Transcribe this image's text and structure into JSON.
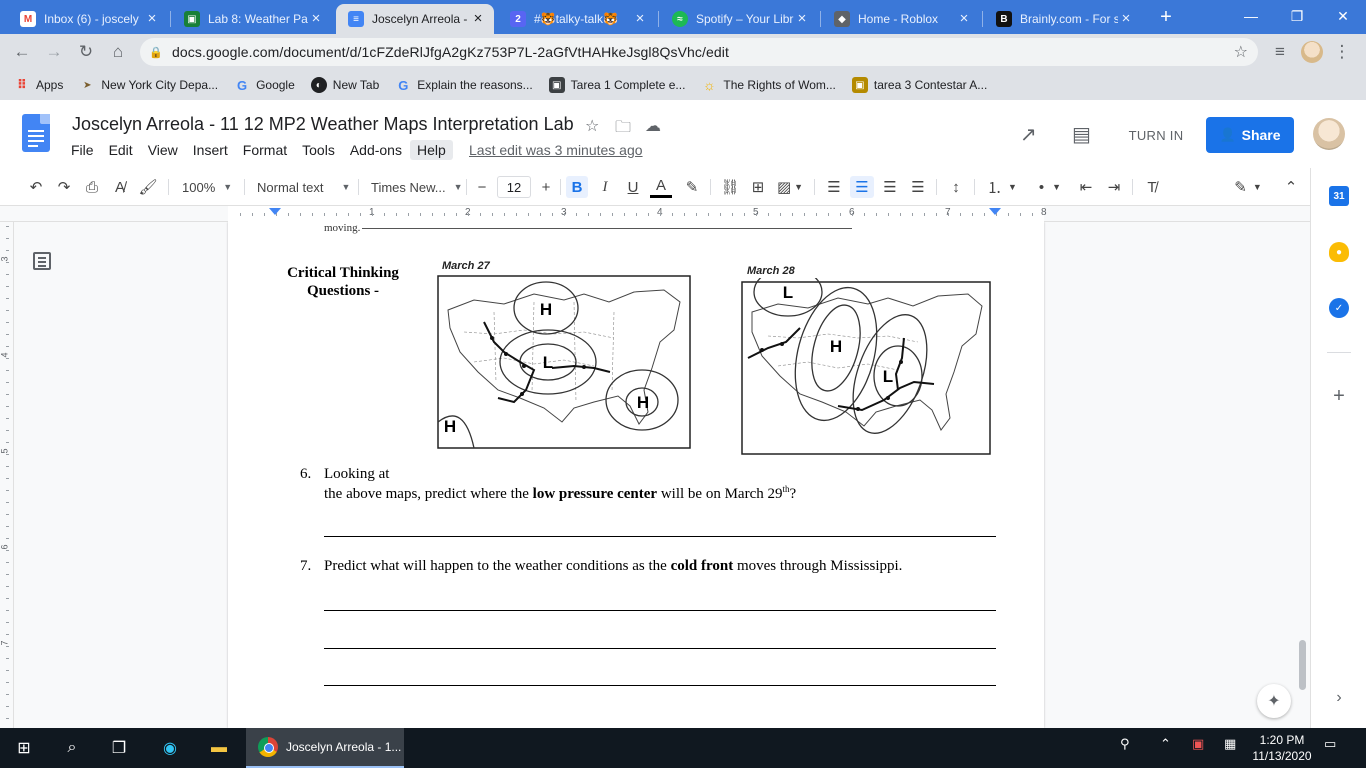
{
  "browser": {
    "tabs": [
      {
        "title": "Inbox (6) - joscely",
        "favicon": "gmail-icon",
        "color": "#ea4335",
        "glyph": "M"
      },
      {
        "title": "Lab 8: Weather Pat",
        "favicon": "classroom-icon",
        "color": "#188038",
        "glyph": "▣"
      },
      {
        "title": "Joscelyn Arreola -",
        "favicon": "docs-icon",
        "color": "#4285f4",
        "glyph": "≡",
        "active": true
      },
      {
        "title": "#🐯talky-talk🐯",
        "favicon": "discord-icon",
        "color": "#5865f2",
        "glyph": "2"
      },
      {
        "title": "Spotify – Your Libr",
        "favicon": "spotify-icon",
        "color": "#1db954",
        "glyph": "≈"
      },
      {
        "title": "Home - Roblox",
        "favicon": "roblox-icon",
        "color": "#444444",
        "glyph": "◆"
      },
      {
        "title": "Brainly.com - For s",
        "favicon": "brainly-icon",
        "color": "#111111",
        "glyph": "B"
      }
    ],
    "url": "docs.google.com/document/d/1cFZdeRlJfgA2gKz753P7L-2aGfVtHAHkeJsgl8QsVhc/edit",
    "bookmarks": [
      {
        "label": "Apps",
        "icon": "apps-grid-icon",
        "color": "#ea4335"
      },
      {
        "label": "New York City Depa...",
        "icon": "nyc-doe-icon",
        "color": "#7b5e2e"
      },
      {
        "label": "Google",
        "icon": "google-icon",
        "color": "#4285f4"
      },
      {
        "label": "New Tab",
        "icon": "globe-icon",
        "color": "#202124"
      },
      {
        "label": "Explain the reasons...",
        "icon": "google-icon",
        "color": "#4285f4"
      },
      {
        "label": "Tarea 1 Complete e...",
        "icon": "classroom-icon",
        "color": "#3c4043"
      },
      {
        "label": "The Rights of Wom...",
        "icon": "sun-icon",
        "color": "#f4b400"
      },
      {
        "label": "tarea 3 Contestar A...",
        "icon": "classroom-icon",
        "color": "#b48a00"
      }
    ]
  },
  "docs": {
    "title": "Joscelyn Arreola - 11 12 MP2 Weather Maps Interpretation Lab",
    "menu": [
      "File",
      "Edit",
      "View",
      "Insert",
      "Format",
      "Tools",
      "Add-ons",
      "Help"
    ],
    "last_edit": "Last edit was 3 minutes ago",
    "turn_in": "TURN IN",
    "share": "Share",
    "toolbar": {
      "zoom": "100%",
      "style": "Normal text",
      "font": "Times New...",
      "font_size": "12"
    },
    "ruler_numbers": [
      "1",
      "2",
      "3",
      "4",
      "5",
      "6",
      "7",
      "8"
    ],
    "vruler_numbers": [
      "3",
      "4",
      "5",
      "6",
      "7"
    ]
  },
  "content": {
    "top_fragment": "moving.",
    "critical_title": "Critical Thinking Questions -",
    "map1": {
      "date": "March 27",
      "pressure_labels": [
        "H",
        "L",
        "H",
        "H"
      ]
    },
    "map2": {
      "date": "March 28",
      "pressure_labels": [
        "L",
        "H",
        "L"
      ]
    },
    "q6": {
      "num": "6.",
      "line1": "Looking at",
      "pre": "the above maps, predict where the ",
      "bold": "low pressure center",
      "post": " will be on March 29",
      "sup": "th",
      "end": "?"
    },
    "q7": {
      "num": "7.",
      "pre": "Predict what will happen to the weather conditions as the ",
      "bold": "cold front",
      "post": " moves through Mississippi."
    }
  },
  "taskbar": {
    "app_label": "Joscelyn Arreola - 1...",
    "time": "1:20 PM",
    "date": "11/13/2020"
  }
}
